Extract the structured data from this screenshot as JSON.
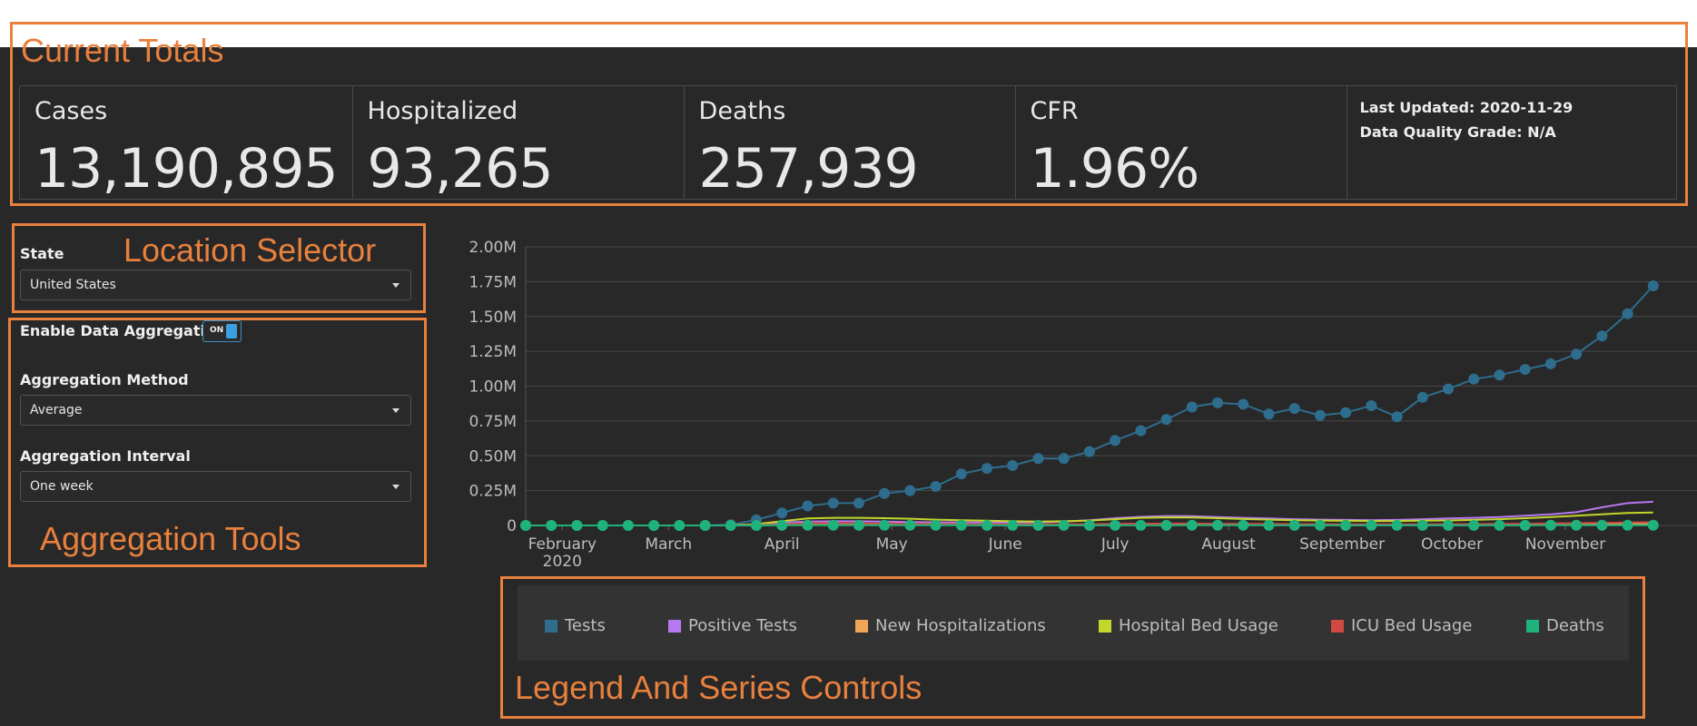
{
  "annotations": {
    "current_totals": "Current Totals",
    "location_selector": "Location Selector",
    "aggregation_tools": "Aggregation Tools",
    "legend_controls": "Legend And Series Controls"
  },
  "totals": {
    "cases": {
      "label": "Cases",
      "value": "13,190,895"
    },
    "hospitalized": {
      "label": "Hospitalized",
      "value": "93,265"
    },
    "deaths": {
      "label": "Deaths",
      "value": "257,939"
    },
    "cfr": {
      "label": "CFR",
      "value": "1.96%"
    },
    "last_updated": "Last Updated: 2020-11-29",
    "data_quality": "Data Quality Grade: N/A"
  },
  "location": {
    "label": "State",
    "value": "United States"
  },
  "aggregation": {
    "enable_label": "Enable Data Aggregation",
    "toggle_text": "ON",
    "toggle_on": true,
    "method_label": "Aggregation Method",
    "method_value": "Average",
    "interval_label": "Aggregation Interval",
    "interval_value": "One week"
  },
  "legend": {
    "tests": "Tests",
    "positive": "Positive Tests",
    "new_hosp": "New Hospitalizations",
    "bed_usage": "Hospital Bed Usage",
    "icu": "ICU Bed Usage",
    "deaths": "Deaths"
  },
  "colors": {
    "tests": "#2e6d8e",
    "positive": "#b679f0",
    "new_hosp": "#f0a657",
    "bed_usage": "#c3d62b",
    "icu": "#d04a43",
    "deaths": "#1fb27a",
    "annotation": "#e8803e"
  },
  "chart_data": {
    "type": "line",
    "y_tick_labels": [
      "0",
      "0.25M",
      "0.50M",
      "0.75M",
      "1.00M",
      "1.25M",
      "1.50M",
      "1.75M",
      "2.00M"
    ],
    "ylim": [
      0,
      2000000
    ],
    "x_tick_labels": [
      "February",
      "March",
      "April",
      "May",
      "June",
      "July",
      "August",
      "September",
      "October",
      "November"
    ],
    "x_tick_sublabel": "2020",
    "x_tick_days": [
      31,
      60,
      91,
      121,
      152,
      182,
      213,
      244,
      274,
      305
    ],
    "x": [
      "2020-01-22",
      "2020-01-29",
      "2020-02-05",
      "2020-02-12",
      "2020-02-19",
      "2020-02-26",
      "2020-03-04",
      "2020-03-11",
      "2020-03-18",
      "2020-03-25",
      "2020-04-01",
      "2020-04-08",
      "2020-04-15",
      "2020-04-22",
      "2020-04-29",
      "2020-05-06",
      "2020-05-13",
      "2020-05-20",
      "2020-05-27",
      "2020-06-03",
      "2020-06-10",
      "2020-06-17",
      "2020-06-24",
      "2020-07-01",
      "2020-07-08",
      "2020-07-15",
      "2020-07-22",
      "2020-07-29",
      "2020-08-05",
      "2020-08-12",
      "2020-08-19",
      "2020-08-26",
      "2020-09-02",
      "2020-09-09",
      "2020-09-16",
      "2020-09-23",
      "2020-09-30",
      "2020-10-07",
      "2020-10-14",
      "2020-10-21",
      "2020-10-28",
      "2020-11-04",
      "2020-11-11",
      "2020-11-18",
      "2020-11-25"
    ],
    "series": [
      {
        "name": "Tests",
        "values": [
          0,
          0,
          0,
          0,
          0,
          0,
          0,
          0,
          5000,
          40000,
          90000,
          140000,
          160000,
          160000,
          230000,
          250000,
          280000,
          370000,
          410000,
          430000,
          480000,
          480000,
          530000,
          610000,
          680000,
          760000,
          850000,
          880000,
          870000,
          800000,
          840000,
          790000,
          810000,
          860000,
          780000,
          920000,
          980000,
          1050000,
          1080000,
          1120000,
          1160000,
          1230000,
          1360000,
          1520000,
          1720000
        ]
      },
      {
        "name": "Positive Tests",
        "values": [
          0,
          0,
          0,
          0,
          0,
          0,
          0,
          0,
          1000,
          8000,
          20000,
          28000,
          30000,
          30000,
          28000,
          25000,
          23000,
          22000,
          21000,
          20000,
          22000,
          28000,
          38000,
          52000,
          62000,
          68000,
          67000,
          60000,
          55000,
          50000,
          45000,
          42000,
          40000,
          38000,
          40000,
          45000,
          50000,
          55000,
          60000,
          70000,
          80000,
          95000,
          130000,
          160000,
          170000
        ]
      },
      {
        "name": "New Hospitalizations",
        "values": [
          0,
          0,
          0,
          0,
          0,
          0,
          0,
          0,
          200,
          2000,
          5000,
          7000,
          6500,
          5500,
          5000,
          4200,
          3500,
          3000,
          2500,
          2200,
          2100,
          2300,
          3000,
          4200,
          5000,
          5200,
          5000,
          4500,
          4000,
          3500,
          3200,
          3000,
          2900,
          2800,
          3000,
          3300,
          3800,
          4200,
          4800,
          5800,
          6800,
          8000,
          10000,
          11500,
          12000
        ]
      },
      {
        "name": "Hospital Bed Usage",
        "values": [
          0,
          0,
          0,
          0,
          0,
          0,
          0,
          0,
          500,
          10000,
          30000,
          50000,
          55000,
          55000,
          52000,
          48000,
          42000,
          38000,
          34000,
          30000,
          28000,
          30000,
          35000,
          45000,
          55000,
          58000,
          57000,
          52000,
          46000,
          42000,
          38000,
          35000,
          33000,
          32000,
          32000,
          34000,
          36000,
          40000,
          45000,
          52000,
          60000,
          70000,
          80000,
          90000,
          93000
        ]
      },
      {
        "name": "ICU Bed Usage",
        "values": [
          0,
          0,
          0,
          0,
          0,
          0,
          0,
          0,
          100,
          3000,
          9000,
          15000,
          16000,
          15500,
          14000,
          12500,
          11000,
          10000,
          9000,
          8000,
          7500,
          8000,
          9000,
          11000,
          13000,
          14000,
          13800,
          12500,
          11500,
          10500,
          9500,
          9000,
          8500,
          8300,
          8300,
          8700,
          9300,
          10000,
          11000,
          12500,
          14500,
          16500,
          19000,
          21000,
          22000
        ]
      },
      {
        "name": "Deaths",
        "values": [
          0,
          0,
          0,
          0,
          0,
          0,
          0,
          0,
          50,
          200,
          1000,
          1800,
          2200,
          2000,
          1800,
          1500,
          1200,
          1000,
          900,
          700,
          600,
          550,
          500,
          650,
          800,
          950,
          1050,
          1050,
          1000,
          950,
          900,
          850,
          800,
          750,
          700,
          700,
          750,
          750,
          800,
          850,
          1000,
          1200,
          1400,
          1600,
          1750
        ]
      }
    ]
  }
}
